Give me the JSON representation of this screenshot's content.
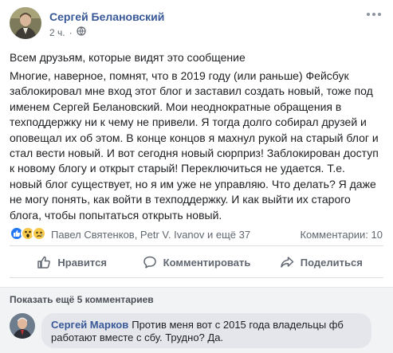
{
  "post": {
    "author": "Сергей Белановский",
    "time": "2 ч.",
    "lead": "Всем друзьям, которые видят это сообщение",
    "text": "Многие, наверное, помнят, что в 2019 году (или раньше) Фейсбук\nзаблокировал мне вход этот блог и заставил создать новый, тоже под\nименем Сергей Белановский. Мои неоднократные обращения в\nтехподдержку ни к чему не привели. Я тогда долго собирал друзей и\nоповещал их об этом. В конце концов я махнул рукой на старый блог и\nстал вести новый. И вот сегодня новый сюрприз! Заблокирован доступ\nк новому блогу и открыт старый! Переключиться не удается. Т.е.\nновый блог существует, но я им уже не управляю. Что делать? Я даже\nне могу понять, как войти в техподдержку. И как выйти их старого\nблога, чтобы попытаться открыть новый."
  },
  "reactions": {
    "icons": [
      "like-icon",
      "wow-icon",
      "sad-icon"
    ],
    "names": "Павел Святенков, Petr V. Ivanov и ещё 37",
    "comments_count": "Комментарии: 10"
  },
  "actions": {
    "like": "Нравится",
    "comment": "Комментировать",
    "share": "Поделиться"
  },
  "comments": {
    "show_more": "Показать ещё 5 комментариев",
    "items": [
      {
        "author": "Сергей Марков",
        "text": "Против меня вот с 2015 года владельцы фб работают вместе с сбу. Трудно? Да."
      }
    ]
  }
}
